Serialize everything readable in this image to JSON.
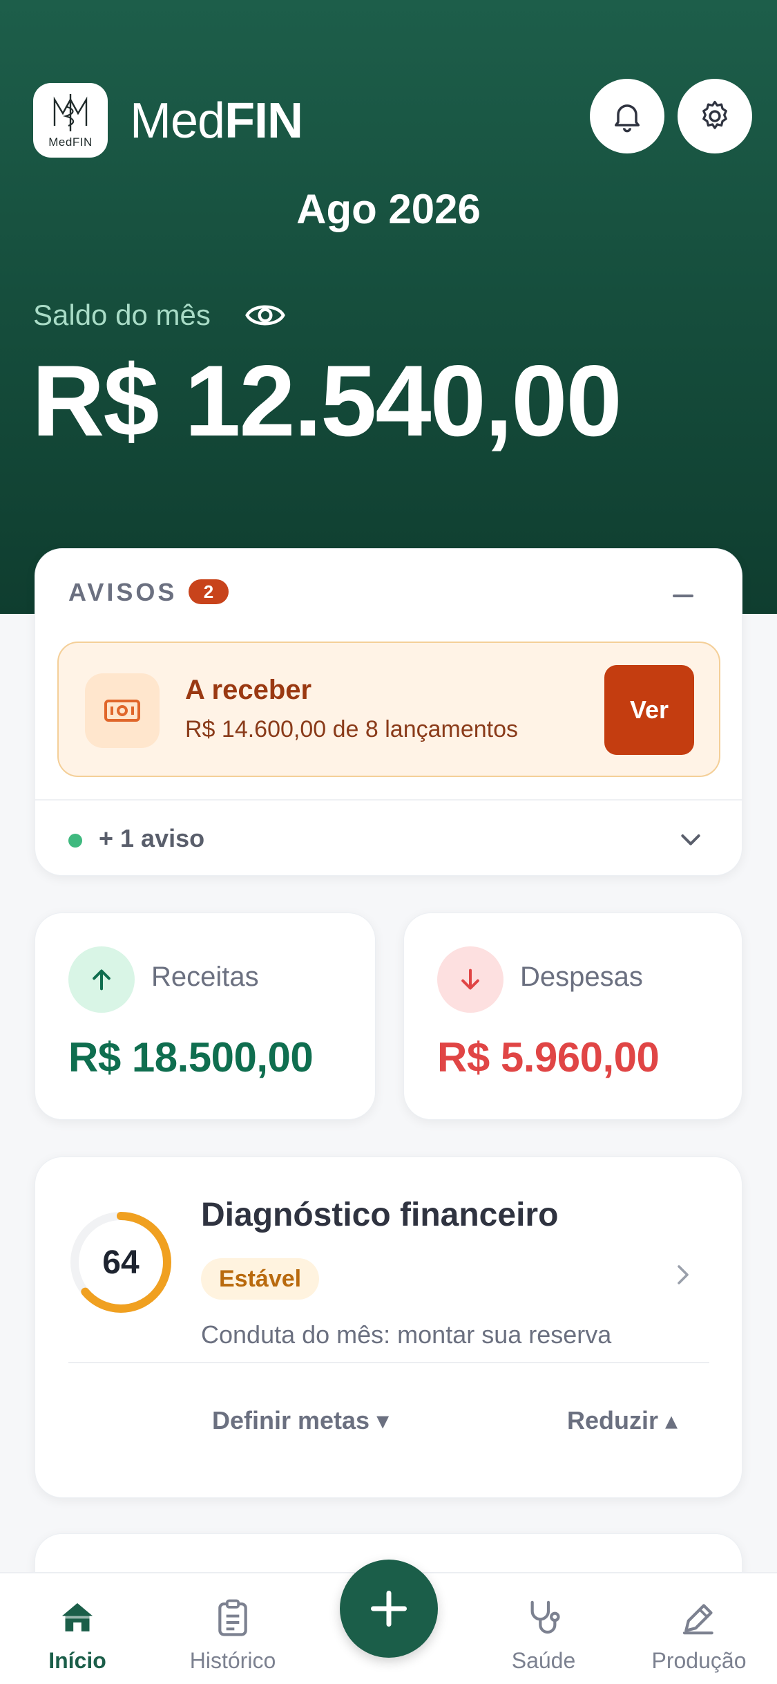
{
  "app": {
    "logo_text": "MedFIN",
    "brand_light": "Med",
    "brand_bold": "FIN"
  },
  "header": {
    "month": "Ago 2026",
    "balance_label": "Saldo do mês",
    "balance_value": "R$ 12.540,00"
  },
  "avisos": {
    "title": "AVISOS",
    "count": "2",
    "alert": {
      "title": "A receber",
      "subtitle": "R$ 14.600,00 de 8 lançamentos",
      "action_label": "Ver"
    },
    "more_label": "+ 1 aviso"
  },
  "summary": {
    "income_label": "Receitas",
    "income_value": "R$ 18.500,00",
    "expense_label": "Despesas",
    "expense_value": "R$ 5.960,00"
  },
  "diagnostico": {
    "score": "64",
    "score_fraction": 0.64,
    "title": "Diagnóstico financeiro",
    "status": "Estável",
    "conduct": "Conduta do mês: montar sua reserva",
    "action_left": "Definir metas ▾",
    "action_right": "Reduzir ▴"
  },
  "tabbar": {
    "items": [
      {
        "label": "Início",
        "icon": "home-icon",
        "active": true
      },
      {
        "label": "Histórico",
        "icon": "clipboard-icon",
        "active": false
      },
      {
        "label": "Saúde",
        "icon": "stethoscope-icon",
        "active": false
      },
      {
        "label": "Produção",
        "icon": "pen-icon",
        "active": false
      }
    ]
  },
  "colors": {
    "primary": "#1b5e49",
    "income": "#0f6e4f",
    "expense": "#e04545",
    "alert_accent": "#c43d10",
    "gauge": "#f0a020"
  }
}
